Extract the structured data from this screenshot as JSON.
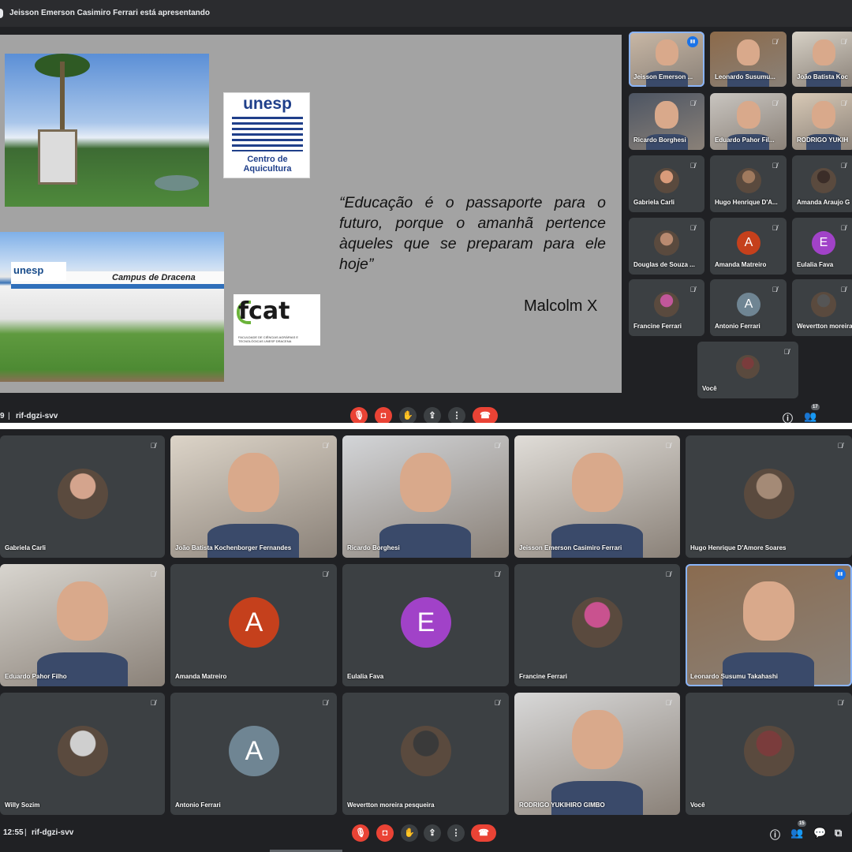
{
  "top": {
    "presenter_banner": "Jeisson Emerson Casimiro Ferrari está apresentando",
    "slide": {
      "logo_unesp_title": "unesp",
      "logo_unesp_subtitle": "Centro de Aquicultura",
      "campus_text": "Campus de Dracena",
      "photo_logo": "unesp",
      "fcat_text": "fcat",
      "fcat_subtitle": "FACULDADE DE CIÊNCIAS AGRÁRIAS E TECNOLÓGICAS UNESP DRACENA",
      "quote": "“Educação é o passaporte para o futuro, porque o amanhã pertence àqueles que se preparam para ele hoje”",
      "author": "Malcolm X"
    },
    "participants": [
      {
        "name": "Jeisson Emerson ..."
      },
      {
        "name": "Leonardo Susumu..."
      },
      {
        "name": "João Batista Koc"
      },
      {
        "name": "Ricardo Borghesi"
      },
      {
        "name": "Eduardo Pahor Fil..."
      },
      {
        "name": "RODRIGO YUKIH"
      },
      {
        "name": "Gabriela Carli"
      },
      {
        "name": "Hugo Henrique D'A..."
      },
      {
        "name": "Amanda Araujo G"
      },
      {
        "name": "Douglas de Souza ..."
      },
      {
        "name": "Amanda Matreiro",
        "initial": "A",
        "color": "#c5401c"
      },
      {
        "name": "Eulalia Fava",
        "initial": "E",
        "color": "#a142c8"
      },
      {
        "name": "Francine Ferrari"
      },
      {
        "name": "Antonio Ferrari",
        "initial": "A",
        "color": "#6f8593"
      },
      {
        "name": "Wevertton moreira"
      },
      {
        "name": "Você"
      }
    ],
    "bar": {
      "time_fragment": "9",
      "meeting_code": "rif-dgzi-svv",
      "people_count": "17"
    }
  },
  "bottom": {
    "participants": [
      {
        "name": "Gabriela Carli"
      },
      {
        "name": "João Batista Kochenborger Fernandes"
      },
      {
        "name": "Ricardo Borghesi"
      },
      {
        "name": "Jeisson Emerson Casimiro Ferrari"
      },
      {
        "name": "Hugo Henrique D'Amore Soares"
      },
      {
        "name": "Eduardo Pahor Filho"
      },
      {
        "name": "Amanda Matreiro",
        "initial": "A",
        "color": "#c5401c"
      },
      {
        "name": "Eulalia Fava",
        "initial": "E",
        "color": "#a142c8"
      },
      {
        "name": "Francine Ferrari"
      },
      {
        "name": "Leonardo Susumu Takahashi"
      },
      {
        "name": "Willy Sozim"
      },
      {
        "name": "Antonio Ferrari",
        "initial": "A",
        "color": "#6f8593"
      },
      {
        "name": "Wevertton moreira pesqueira"
      },
      {
        "name": "RODRIGO YUKIHIRO GIMBO"
      },
      {
        "name": "Você"
      }
    ],
    "bar": {
      "time": "12:55",
      "separator": "|",
      "meeting_code": "rif-dgzi-svv",
      "people_count": "15"
    }
  },
  "icons": [
    "mic-off-icon",
    "camera-off-icon",
    "raise-hand-icon",
    "present-icon",
    "more-options-icon",
    "end-call-icon",
    "info-icon",
    "people-icon",
    "chat-icon",
    "activities-icon"
  ],
  "colors": {
    "background": "#202124",
    "tile": "#3c4043",
    "end_call": "#ea4335",
    "active_speaker": "#8ab4f8"
  }
}
